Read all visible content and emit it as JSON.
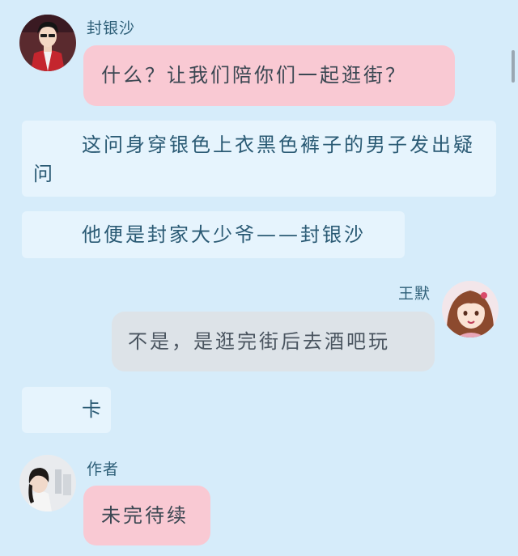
{
  "messages": [
    {
      "type": "left",
      "sender": "封银沙",
      "avatar_icon": "boy-red-vest-avatar-icon",
      "text": "什么？让我们陪你们一起逛街？"
    },
    {
      "type": "narration",
      "text": "这问身穿银色上衣黑色裤子的男子发出疑问"
    },
    {
      "type": "narration",
      "text": "他便是封家大少爷——封银沙"
    },
    {
      "type": "right",
      "sender": "王默",
      "avatar_icon": "girl-brown-hair-avatar-icon",
      "text": "不是，是逛完街后去酒吧玩"
    },
    {
      "type": "narration",
      "text": "卡"
    },
    {
      "type": "left",
      "sender": "作者",
      "avatar_icon": "author-photo-avatar-icon",
      "text": "未完待续"
    }
  ],
  "colors": {
    "background": "#d6ecfa",
    "pink_bubble": "#f9c9d3",
    "gray_bubble": "#dde3e8",
    "narration_box": "#e6f4fd",
    "name_text": "#2e5f78"
  }
}
